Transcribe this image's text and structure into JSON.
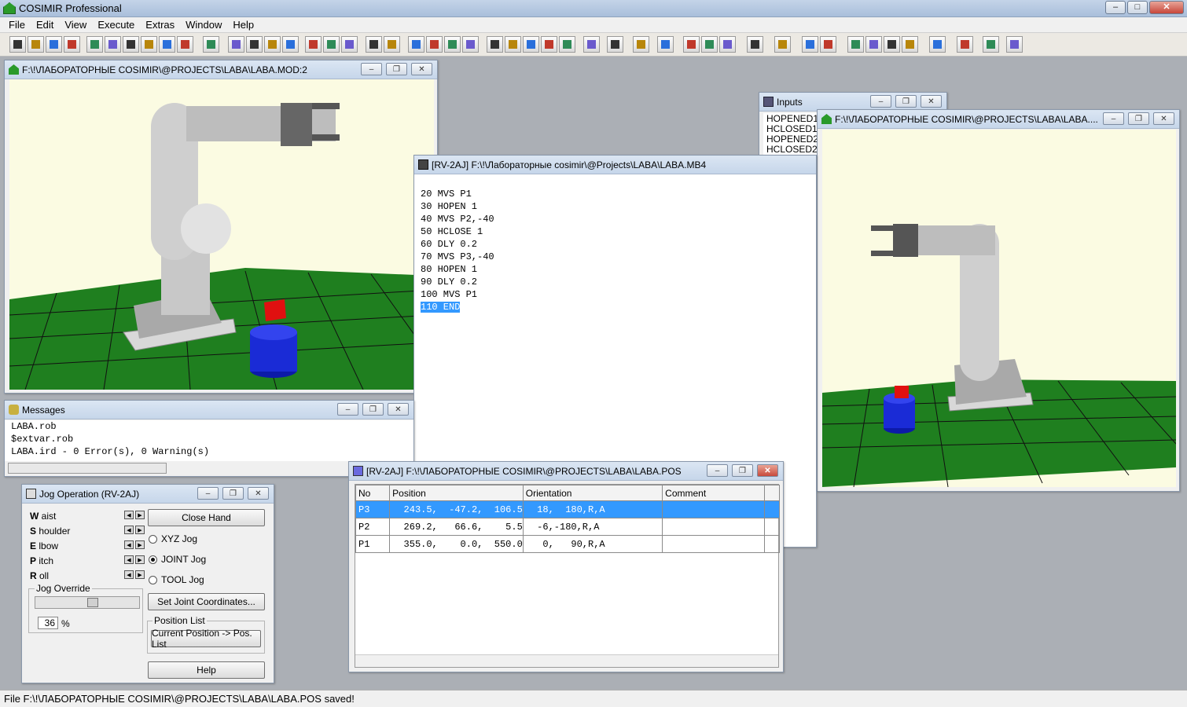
{
  "app": {
    "title": "COSIMIR Professional"
  },
  "menu": [
    "File",
    "Edit",
    "View",
    "Execute",
    "Extras",
    "Window",
    "Help"
  ],
  "windows": {
    "model_view": {
      "title": "F:\\!\\ЛАБОРАТОРНЫЕ COSIMIR\\@PROJECTS\\LABA\\LABA.MOD:2"
    },
    "inputs": {
      "title": "Inputs",
      "items": [
        "HOPENED1",
        "HCLOSED1",
        "HOPENED2",
        "HCLOSED2"
      ]
    },
    "model_view2": {
      "title": "F:\\!\\ЛАБОРАТОРНЫЕ COSIMIR\\@PROJECTS\\LABA\\LABA...."
    },
    "program": {
      "title": "[RV-2AJ] F:\\!\\Лабораторные cosimir\\@Projects\\LABA\\LABA.MB4",
      "lines": [
        "20 MVS P1",
        "30 HOPEN 1",
        "40 MVS P2,-40",
        "50 HCLOSE 1",
        "60 DLY 0.2",
        "70 MVS P3,-40",
        "80 HOPEN 1",
        "90 DLY 0.2",
        "100 MVS P1",
        "110 END"
      ]
    },
    "messages": {
      "title": "Messages",
      "lines": [
        "LABA.rob",
        "$extvar.rob",
        "LABA.ird - 0 Error(s), 0 Warning(s)"
      ]
    },
    "jog": {
      "title": "Jog Operation (RV-2AJ)",
      "joints": [
        {
          "key": "W",
          "rest": " aist"
        },
        {
          "key": "S",
          "rest": " houlder"
        },
        {
          "key": "E",
          "rest": " lbow"
        },
        {
          "key": "P",
          "rest": " itch"
        },
        {
          "key": "R",
          "rest": " oll"
        }
      ],
      "close_hand": "Close Hand",
      "xyz": "XYZ Jog",
      "joint": "JOINT Jog",
      "tool": "TOOL Jog",
      "override_label": "Jog Override",
      "override_value": "36",
      "override_unit": "%",
      "set_joint": "Set Joint Coordinates...",
      "poslist_label": "Position List",
      "cur_pos": "Current Position -> Pos. List",
      "help": "Help",
      "selected_mode": "JOINT Jog"
    },
    "poslist": {
      "title": "[RV-2AJ] F:\\!\\ЛАБОРАТОРНЫЕ COSIMIR\\@PROJECTS\\LABA\\LABA.POS",
      "columns": [
        "No",
        "Position",
        "Orientation",
        "Comment"
      ],
      "rows": [
        {
          "no": "P3",
          "position": "  243.5,  -47.2,  106.5",
          "orientation": "  18,  180,R,A",
          "comment": ""
        },
        {
          "no": "P2",
          "position": "  269.2,   66.6,    5.5",
          "orientation": "  -6,-180,R,A",
          "comment": ""
        },
        {
          "no": "P1",
          "position": "  355.0,    0.0,  550.0",
          "orientation": "   0,   90,R,A",
          "comment": ""
        }
      ]
    }
  },
  "status": {
    "text": "File F:\\!\\ЛАБОРАТОРНЫЕ COSIMIR\\@PROJECTS\\LABA\\LABA.POS saved!"
  },
  "colors": {
    "floor": "#1f7f1f",
    "selection": "#3399ff",
    "cylinder": "#1a2bd6",
    "cube": "#e01010",
    "robot": "#c8c8c8"
  }
}
